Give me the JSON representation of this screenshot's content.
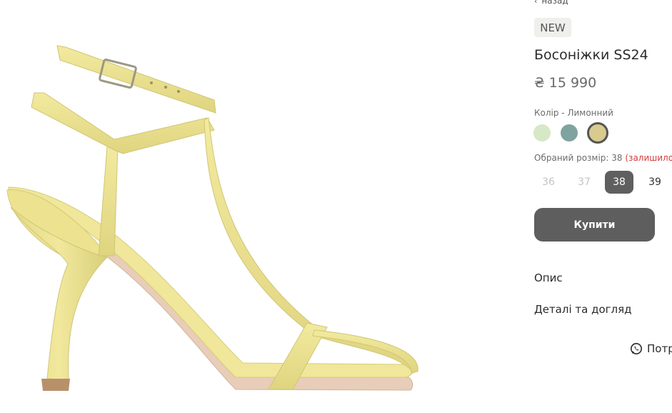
{
  "nav": {
    "back_label": "назад"
  },
  "product": {
    "badge": "NEW",
    "title": "Босоніжки SS24",
    "price": "₴ 15 990",
    "color_label": "Колір - Лимонний",
    "colors": [
      {
        "color": "#d6e8c6",
        "selected": false
      },
      {
        "color": "#7fa39f",
        "selected": false
      },
      {
        "color": "#d8cb8d",
        "selected": true
      }
    ],
    "size_label": "Обраний розмір: 38",
    "size_remaining": "(залишило",
    "sizes": [
      {
        "label": "36",
        "state": "disabled"
      },
      {
        "label": "37",
        "state": "disabled"
      },
      {
        "label": "38",
        "state": "active"
      },
      {
        "label": "39",
        "state": "available"
      }
    ],
    "buy_label": "Купити"
  },
  "accordion": [
    {
      "label": "Опис"
    },
    {
      "label": "Деталі та догляд"
    }
  ],
  "help": {
    "label": "Потр",
    "icon": "whatsapp-icon"
  },
  "image": {
    "subject": "sandal-icon",
    "main_color": "#ebe28f"
  }
}
